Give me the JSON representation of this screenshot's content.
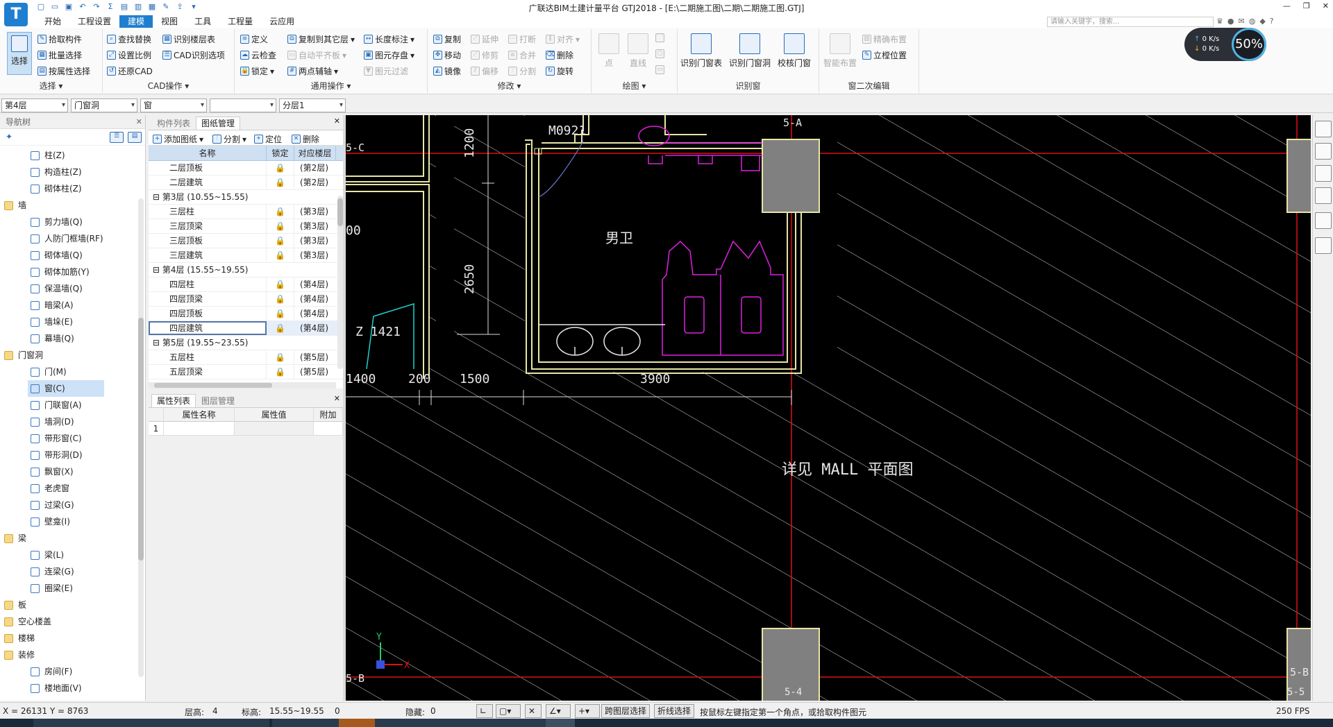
{
  "app": {
    "title": "广联达BIM土建计量平台 GTJ2018 - [E:\\二期施工图\\二期\\二期施工图.GTJ]",
    "logo": "T"
  },
  "menu": {
    "items": [
      "开始",
      "工程设置",
      "建模",
      "视图",
      "工具",
      "工程量",
      "云应用"
    ],
    "active": "建模",
    "search_placeholder": "请输入关键字，搜索..."
  },
  "ribbon": {
    "select": {
      "big": "选择",
      "b1": "拾取构件",
      "b2": "批量选择",
      "b3": "按属性选择",
      "label": "选择 ▾"
    },
    "cad": {
      "b1": "查找替换",
      "b2": "识别楼层表",
      "b3": "设置比例",
      "b4": "CAD识别选项",
      "b5": "还原CAD",
      "label": "CAD操作 ▾"
    },
    "common": {
      "b1": "定义",
      "b2": "复制到其它层",
      "b3": "长度标注",
      "b4": "云检查",
      "b5": "自动平齐板",
      "b6": "图元存盘",
      "b7": "锁定",
      "b8": "两点辅轴",
      "b9": "图元过滤",
      "label": "通用操作 ▾"
    },
    "modify": {
      "b1": "复制",
      "b2": "延伸",
      "b3": "打断",
      "b4": "对齐",
      "b5": "移动",
      "b6": "修剪",
      "b7": "合并",
      "b8": "删除",
      "b9": "镜像",
      "b10": "偏移",
      "b11": "分割",
      "b12": "旋转",
      "label": "修改 ▾"
    },
    "draw": {
      "b1": "点",
      "b2": "直线",
      "label": "绘图 ▾"
    },
    "recognize": {
      "b1": "识别门窗表",
      "b2": "识别门窗洞",
      "b3": "校核门窗",
      "label": "识别窗"
    },
    "secondary": {
      "b1": "智能布置",
      "b2": "精确布置",
      "b3": "立樘位置",
      "label": "窗二次编辑"
    }
  },
  "speed": {
    "up": "0 K/s",
    "down": "0 K/s",
    "percent": "50%"
  },
  "filter": {
    "floor": "第4层",
    "category": "门窗洞",
    "type": "窗",
    "component": "",
    "layer": "分层1"
  },
  "nav": {
    "title": "导航树",
    "rows": [
      {
        "kind": "item",
        "label": "柱(Z)"
      },
      {
        "kind": "item",
        "label": "构造柱(Z)"
      },
      {
        "kind": "item",
        "label": "砌体柱(Z)"
      },
      {
        "kind": "cat",
        "label": "墙"
      },
      {
        "kind": "item",
        "label": "剪力墙(Q)"
      },
      {
        "kind": "item",
        "label": "人防门框墙(RF)"
      },
      {
        "kind": "item",
        "label": "砌体墙(Q)"
      },
      {
        "kind": "item",
        "label": "砌体加筋(Y)"
      },
      {
        "kind": "item",
        "label": "保温墙(Q)"
      },
      {
        "kind": "item",
        "label": "暗梁(A)"
      },
      {
        "kind": "item",
        "label": "墙垛(E)"
      },
      {
        "kind": "item",
        "label": "幕墙(Q)"
      },
      {
        "kind": "cat",
        "label": "门窗洞"
      },
      {
        "kind": "item",
        "label": "门(M)"
      },
      {
        "kind": "item",
        "label": "窗(C)",
        "selected": true
      },
      {
        "kind": "item",
        "label": "门联窗(A)"
      },
      {
        "kind": "item",
        "label": "墙洞(D)"
      },
      {
        "kind": "item",
        "label": "带形窗(C)"
      },
      {
        "kind": "item",
        "label": "带形洞(D)"
      },
      {
        "kind": "item",
        "label": "飘窗(X)"
      },
      {
        "kind": "item",
        "label": "老虎窗"
      },
      {
        "kind": "item",
        "label": "过梁(G)"
      },
      {
        "kind": "item",
        "label": "壁龛(I)"
      },
      {
        "kind": "cat",
        "label": "梁"
      },
      {
        "kind": "item",
        "label": "梁(L)"
      },
      {
        "kind": "item",
        "label": "连梁(G)"
      },
      {
        "kind": "item",
        "label": "圈梁(E)"
      },
      {
        "kind": "cat",
        "label": "板"
      },
      {
        "kind": "cat",
        "label": "空心楼盖"
      },
      {
        "kind": "cat",
        "label": "楼梯"
      },
      {
        "kind": "cat",
        "label": "装修"
      },
      {
        "kind": "item",
        "label": "房间(F)"
      },
      {
        "kind": "item",
        "label": "楼地面(V)"
      }
    ]
  },
  "drawings": {
    "tabs": [
      "构件列表",
      "图纸管理"
    ],
    "active_tab": "图纸管理",
    "toolbar": {
      "add": "添加图纸",
      "split": "分割",
      "locate": "定位",
      "delete": "删除"
    },
    "columns": [
      "名称",
      "锁定",
      "对应楼层"
    ],
    "rows": [
      {
        "kind": "row",
        "name": "二层顶板",
        "floor": "(第2层)"
      },
      {
        "kind": "row",
        "name": "二层建筑",
        "floor": "(第2层)"
      },
      {
        "kind": "grp",
        "name": "第3层 (10.55~15.55)"
      },
      {
        "kind": "row",
        "name": "三层柱",
        "floor": "(第3层)"
      },
      {
        "kind": "row",
        "name": "三层顶梁",
        "floor": "(第3层)"
      },
      {
        "kind": "row",
        "name": "三层顶板",
        "floor": "(第3层)"
      },
      {
        "kind": "row",
        "name": "三层建筑",
        "floor": "(第3层)"
      },
      {
        "kind": "grp",
        "name": "第4层 (15.55~19.55)"
      },
      {
        "kind": "row",
        "name": "四层柱",
        "floor": "(第4层)"
      },
      {
        "kind": "row",
        "name": "四层顶梁",
        "floor": "(第4层)"
      },
      {
        "kind": "row",
        "name": "四层顶板",
        "floor": "(第4层)"
      },
      {
        "kind": "row",
        "name": "四层建筑",
        "floor": "(第4层)",
        "selected": true
      },
      {
        "kind": "grp",
        "name": "第5层 (19.55~23.55)"
      },
      {
        "kind": "row",
        "name": "五层柱",
        "floor": "(第5层)"
      },
      {
        "kind": "row",
        "name": "五层顶梁",
        "floor": "(第5层)"
      }
    ]
  },
  "props": {
    "tabs": [
      "属性列表",
      "图层管理"
    ],
    "active_tab": "属性列表",
    "columns": [
      "属性名称",
      "属性值",
      "附加"
    ],
    "row_num": "1"
  },
  "canvas": {
    "labels": {
      "door": "M0921",
      "room": "男卫",
      "window": "Z 1421",
      "note": "详见 MALL  平面图",
      "axis_c": "5-C",
      "axis_a": "5-A",
      "axis_b_left": "5-B",
      "axis_b_right": "5-B",
      "axis_4": "5-4",
      "axis_5": "5-5",
      "dim_1200": "1200",
      "dim_2650": "2650",
      "dim_1400": "1400",
      "dim_200": "200",
      "dim_1500": "1500",
      "dim_3900": "3900",
      "dim_00": "00",
      "ucs_y": "Y",
      "ucs_x": "X"
    },
    "colors": {
      "wall": "#e8e6a6",
      "axis": "#e01010",
      "fixture": "#e020e0",
      "dim": "#ffffff"
    }
  },
  "status": {
    "coords": "X = 26131 Y = 8763",
    "floor_height_label": "层高:",
    "floor_height": "4",
    "elevation_label": "标高:",
    "elevation": "15.55~19.55",
    "zero": "0",
    "hidden_label": "隐藏:",
    "hidden": "0",
    "btn_cross_floor": "跨图层选择",
    "btn_polyline": "折线选择",
    "hint": "按鼠标左键指定第一个角点，或拾取构件图元",
    "fps": "250 FPS"
  }
}
